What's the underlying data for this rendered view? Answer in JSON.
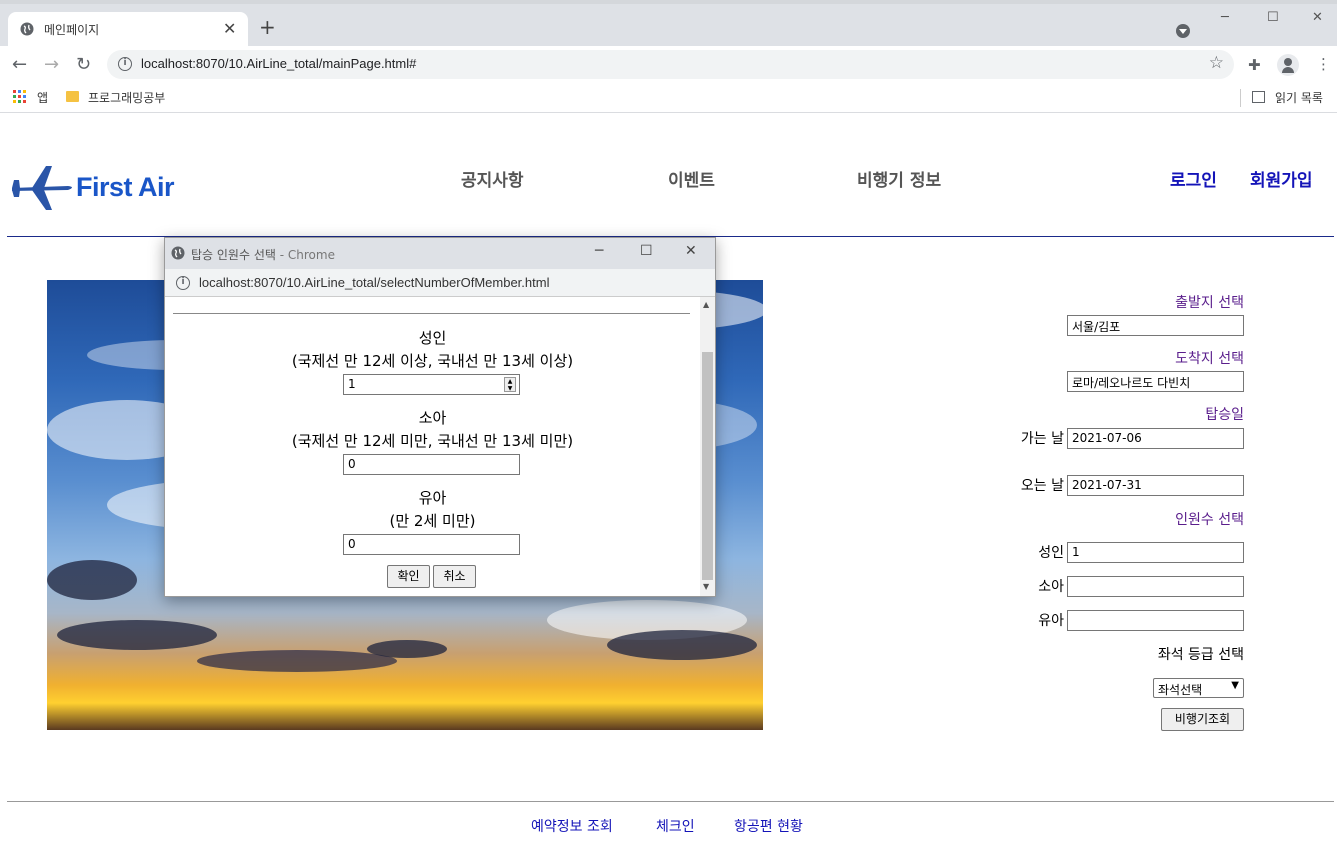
{
  "browser": {
    "tab_title": "메인페이지",
    "url": "localhost:8070/10.AirLine_total/mainPage.html#",
    "bookmarks": {
      "apps": "앱",
      "folder": "프로그래밍공부",
      "reading_list": "읽기 목록"
    }
  },
  "header": {
    "brand": "First Air",
    "nav": [
      "공지사항",
      "이벤트",
      "비행기 정보"
    ],
    "login": "로그인",
    "signup": "회원가입"
  },
  "booking_form": {
    "departure_heading": "출발지 선택",
    "departure_value": "서울/김포",
    "arrival_heading": "도착지 선택",
    "arrival_value": "로마/레오나르도 다빈치",
    "date_heading": "탑승일",
    "depart_label": "가는 날",
    "depart_date": "2021-07-06",
    "return_label": "오는 날",
    "return_date": "2021-07-31",
    "passenger_heading": "인원수 선택",
    "adult_label": "성인",
    "adult_value": "1",
    "child_label": "소아",
    "child_value": "",
    "infant_label": "유아",
    "infant_value": "",
    "seat_heading": "좌석 등급 선택",
    "seat_selected": "좌석선택",
    "search_button": "비행기조회"
  },
  "footer": {
    "links": [
      "예약정보 조회",
      "체크인",
      "항공편 현황"
    ]
  },
  "popup": {
    "title": "탑승 인원수 선택",
    "title_suffix": " - Chrome",
    "url": "localhost:8070/10.AirLine_total/selectNumberOfMember.html",
    "adult_title": "성인",
    "adult_desc": "(국제선 만 12세 이상, 국내선 만 13세 이상)",
    "adult_value": "1",
    "child_title": "소아",
    "child_desc": "(국제선 만 12세 미만, 국내선 만 13세 미만)",
    "child_value": "0",
    "infant_title": "유아",
    "infant_desc": "(만 2세 미만)",
    "infant_value": "0",
    "confirm": "확인",
    "cancel": "취소"
  },
  "colors": {
    "brand_blue": "#1a56c8",
    "link_blue": "#1414b8",
    "heading_purple": "#5a1e8c",
    "header_rule": "#1a2a8a"
  }
}
